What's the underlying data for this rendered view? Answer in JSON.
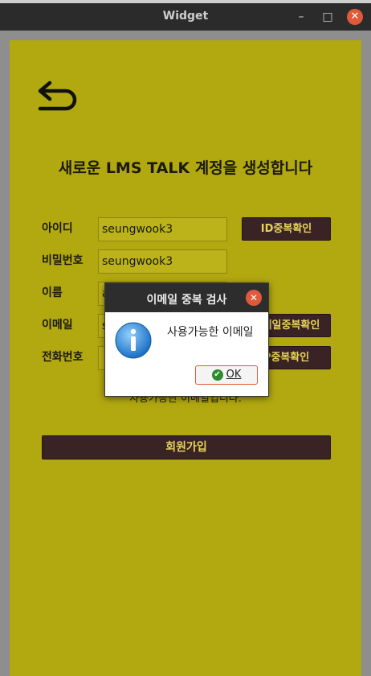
{
  "window": {
    "title": "Widget",
    "minimize": "–",
    "maximize": "□",
    "close": "✕"
  },
  "header": {
    "title": "새로운 LMS TALK 계정을 생성합니다"
  },
  "form": {
    "id_label": "아이디",
    "id_value": "seungwook3",
    "id_check": "ID중복확인",
    "pw_label": "비밀번호",
    "pw_value": "seungwook3",
    "name_label": "이름",
    "name_value": "a",
    "email_label": "이메일",
    "email_value": "se",
    "email_check": "이메일중복확인",
    "phone_label": "전화번호",
    "phone_value": "",
    "phone_check": "P중복확인",
    "status": "사용가능한 이메일입니다.",
    "signup": "회원가입"
  },
  "dialog": {
    "title": "이메일 중복 검사",
    "message": "사용가능한 이메일",
    "ok": "OK",
    "close": "✕"
  },
  "colors": {
    "panel": "#b2a810",
    "button": "#3a2324",
    "button_text": "#e7d35a"
  }
}
